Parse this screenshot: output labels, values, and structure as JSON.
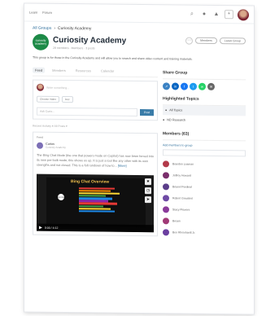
{
  "topbar": {
    "left_text": "Learn",
    "right_text": "Forum"
  },
  "breadcrumb": {
    "parent": "All Groups",
    "separator": "›",
    "current": "Curiosity Academy"
  },
  "group": {
    "logo_text": "curiosity academy",
    "title": "Curiosity Academy",
    "meta": "28 members · Members · 3 posts",
    "description": "This group is for those in the Curiosity Academy and will allow you to search and share video content and training materials.",
    "buttons": [
      "Members",
      "Leave Group"
    ]
  },
  "tabs": [
    "Feed",
    "Members",
    "Resources",
    "Calendar"
  ],
  "composer": {
    "placeholder": "Write something...",
    "chips": [
      "Choose Video",
      "Doc"
    ],
    "ask_placeholder": "Ask Curio...",
    "post_label": "Post"
  },
  "filter_text": "Recent Activity  ▾   All Posts  ▾",
  "post": {
    "label": "Feed",
    "author": "Curios",
    "author_sub": "Curiosity Academy",
    "text": "The Bing Chat Mode (the one that powers mode on Copilot) has now been forced into its new pre-built mode, this shows us up. It is just a tool like any other with its own strengths and not closed. This is a full rundown of how to...",
    "more": "[More]",
    "video_title": "Bing Chat Overview",
    "video_logo": "curios",
    "video_time": "0:00 / 4:12"
  },
  "share": {
    "title": "Share Group",
    "icons": [
      {
        "name": "share-icon",
        "color": "#3b82c4",
        "glyph": "↗"
      },
      {
        "name": "linkedin-icon",
        "color": "#0a66c2",
        "glyph": "in"
      },
      {
        "name": "facebook-icon",
        "color": "#1877f2",
        "glyph": "f"
      },
      {
        "name": "twitter-icon",
        "color": "#1d9bf0",
        "glyph": "t"
      },
      {
        "name": "whatsapp-icon",
        "color": "#25d366",
        "glyph": "w"
      },
      {
        "name": "email-icon",
        "color": "#666666",
        "glyph": "✉"
      }
    ]
  },
  "topics": {
    "title": "Highlighted Topics",
    "items": [
      {
        "label": "All Topics",
        "count": ""
      },
      {
        "label": "ND Research",
        "count": ""
      }
    ]
  },
  "members": {
    "title": "Members (63)",
    "add_label": "Add members to group",
    "list": [
      {
        "name": "Brandon Leaman",
        "color": "#b23a4a"
      },
      {
        "name": "Jeffrey Howard",
        "color": "#7a2e6b"
      },
      {
        "name": "Brianel Ferdinal",
        "color": "#5b3e8a"
      },
      {
        "name": "Robert Grouttest",
        "color": "#6e4aa5"
      },
      {
        "name": "Stacy Flowers",
        "color": "#8a3b9a"
      },
      {
        "name": "Bream",
        "color": "#a03a76"
      },
      {
        "name": "Ben Rheinhardt Jr.",
        "color": "#6b3fa0"
      }
    ]
  }
}
